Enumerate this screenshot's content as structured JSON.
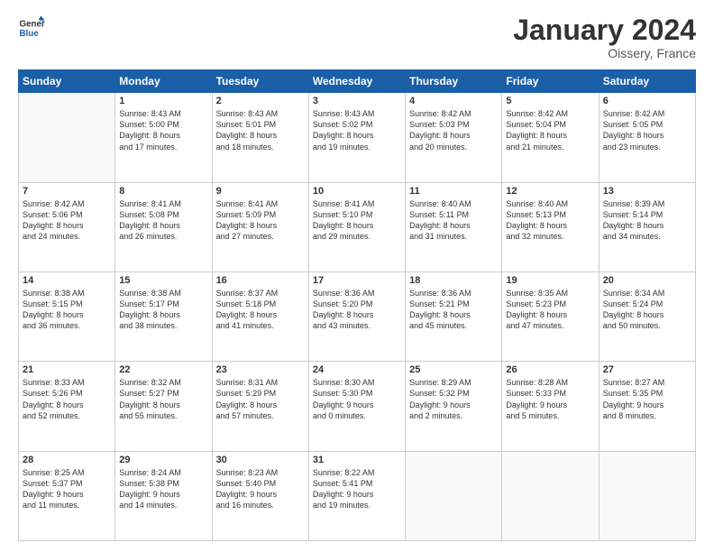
{
  "logo": {
    "line1": "General",
    "line2": "Blue"
  },
  "title": "January 2024",
  "subtitle": "Oissery, France",
  "days_header": [
    "Sunday",
    "Monday",
    "Tuesday",
    "Wednesday",
    "Thursday",
    "Friday",
    "Saturday"
  ],
  "weeks": [
    [
      {
        "day": "",
        "info": ""
      },
      {
        "day": "1",
        "info": "Sunrise: 8:43 AM\nSunset: 5:00 PM\nDaylight: 8 hours\nand 17 minutes."
      },
      {
        "day": "2",
        "info": "Sunrise: 8:43 AM\nSunset: 5:01 PM\nDaylight: 8 hours\nand 18 minutes."
      },
      {
        "day": "3",
        "info": "Sunrise: 8:43 AM\nSunset: 5:02 PM\nDaylight: 8 hours\nand 19 minutes."
      },
      {
        "day": "4",
        "info": "Sunrise: 8:42 AM\nSunset: 5:03 PM\nDaylight: 8 hours\nand 20 minutes."
      },
      {
        "day": "5",
        "info": "Sunrise: 8:42 AM\nSunset: 5:04 PM\nDaylight: 8 hours\nand 21 minutes."
      },
      {
        "day": "6",
        "info": "Sunrise: 8:42 AM\nSunset: 5:05 PM\nDaylight: 8 hours\nand 23 minutes."
      }
    ],
    [
      {
        "day": "7",
        "info": ""
      },
      {
        "day": "8",
        "info": "Sunrise: 8:41 AM\nSunset: 5:08 PM\nDaylight: 8 hours\nand 26 minutes."
      },
      {
        "day": "9",
        "info": "Sunrise: 8:41 AM\nSunset: 5:09 PM\nDaylight: 8 hours\nand 27 minutes."
      },
      {
        "day": "10",
        "info": "Sunrise: 8:41 AM\nSunset: 5:10 PM\nDaylight: 8 hours\nand 29 minutes."
      },
      {
        "day": "11",
        "info": "Sunrise: 8:40 AM\nSunset: 5:11 PM\nDaylight: 8 hours\nand 31 minutes."
      },
      {
        "day": "12",
        "info": "Sunrise: 8:40 AM\nSunset: 5:13 PM\nDaylight: 8 hours\nand 32 minutes."
      },
      {
        "day": "13",
        "info": "Sunrise: 8:39 AM\nSunset: 5:14 PM\nDaylight: 8 hours\nand 34 minutes."
      }
    ],
    [
      {
        "day": "14",
        "info": ""
      },
      {
        "day": "15",
        "info": "Sunrise: 8:38 AM\nSunset: 5:17 PM\nDaylight: 8 hours\nand 38 minutes."
      },
      {
        "day": "16",
        "info": "Sunrise: 8:37 AM\nSunset: 5:18 PM\nDaylight: 8 hours\nand 41 minutes."
      },
      {
        "day": "17",
        "info": "Sunrise: 8:36 AM\nSunset: 5:20 PM\nDaylight: 8 hours\nand 43 minutes."
      },
      {
        "day": "18",
        "info": "Sunrise: 8:36 AM\nSunset: 5:21 PM\nDaylight: 8 hours\nand 45 minutes."
      },
      {
        "day": "19",
        "info": "Sunrise: 8:35 AM\nSunset: 5:23 PM\nDaylight: 8 hours\nand 47 minutes."
      },
      {
        "day": "20",
        "info": "Sunrise: 8:34 AM\nSunset: 5:24 PM\nDaylight: 8 hours\nand 50 minutes."
      }
    ],
    [
      {
        "day": "21",
        "info": ""
      },
      {
        "day": "22",
        "info": "Sunrise: 8:32 AM\nSunset: 5:27 PM\nDaylight: 8 hours\nand 55 minutes."
      },
      {
        "day": "23",
        "info": "Sunrise: 8:31 AM\nSunset: 5:29 PM\nDaylight: 8 hours\nand 57 minutes."
      },
      {
        "day": "24",
        "info": "Sunrise: 8:30 AM\nSunset: 5:30 PM\nDaylight: 9 hours\nand 0 minutes."
      },
      {
        "day": "25",
        "info": "Sunrise: 8:29 AM\nSunset: 5:32 PM\nDaylight: 9 hours\nand 2 minutes."
      },
      {
        "day": "26",
        "info": "Sunrise: 8:28 AM\nSunset: 5:33 PM\nDaylight: 9 hours\nand 5 minutes."
      },
      {
        "day": "27",
        "info": "Sunrise: 8:27 AM\nSunset: 5:35 PM\nDaylight: 9 hours\nand 8 minutes."
      }
    ],
    [
      {
        "day": "28",
        "info": ""
      },
      {
        "day": "29",
        "info": "Sunrise: 8:24 AM\nSunset: 5:38 PM\nDaylight: 9 hours\nand 14 minutes."
      },
      {
        "day": "30",
        "info": "Sunrise: 8:23 AM\nSunset: 5:40 PM\nDaylight: 9 hours\nand 16 minutes."
      },
      {
        "day": "31",
        "info": "Sunrise: 8:22 AM\nSunset: 5:41 PM\nDaylight: 9 hours\nand 19 minutes."
      },
      {
        "day": "",
        "info": ""
      },
      {
        "day": "",
        "info": ""
      },
      {
        "day": "",
        "info": ""
      }
    ]
  ],
  "week1_day7_info": "Sunrise: 8:42 AM\nSunset: 5:06 PM\nDaylight: 8 hours\nand 24 minutes.",
  "week2_day14_info": "Sunrise: 8:38 AM\nSunset: 5:15 PM\nDaylight: 8 hours\nand 36 minutes.",
  "week3_day21_info": "Sunrise: 8:33 AM\nSunset: 5:26 PM\nDaylight: 8 hours\nand 52 minutes.",
  "week4_day28_info": "Sunrise: 8:25 AM\nSunset: 5:37 PM\nDaylight: 9 hours\nand 11 minutes."
}
